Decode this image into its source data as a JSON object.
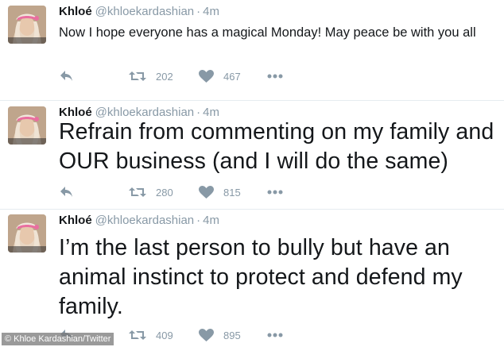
{
  "tweets": [
    {
      "name": "Khloé",
      "handle": "@khloekardashian",
      "separator": "·",
      "time": "4m",
      "text": "Now I hope everyone has a magical Monday! May peace be with you all",
      "retweets": "202",
      "likes": "467"
    },
    {
      "name": "Khloé",
      "handle": "@khloekardashian",
      "separator": "·",
      "time": "4m",
      "text": "Refrain from commenting on my family and OUR business (and I will do the same)",
      "retweets": "280",
      "likes": "815"
    },
    {
      "name": "Khloé",
      "handle": "@khloekardashian",
      "separator": "·",
      "time": "4m",
      "text": "I’m the last person to bully but have an animal instinct to protect and defend my family.",
      "retweets": "409",
      "likes": "895"
    }
  ],
  "credit": "© Khloe Kardashian/Twitter",
  "colors": {
    "text": "#14171a",
    "muted": "#8899a6",
    "divider": "#e6ecf0"
  },
  "icons": [
    "reply-icon",
    "retweet-icon",
    "heart-icon",
    "more-icon"
  ]
}
